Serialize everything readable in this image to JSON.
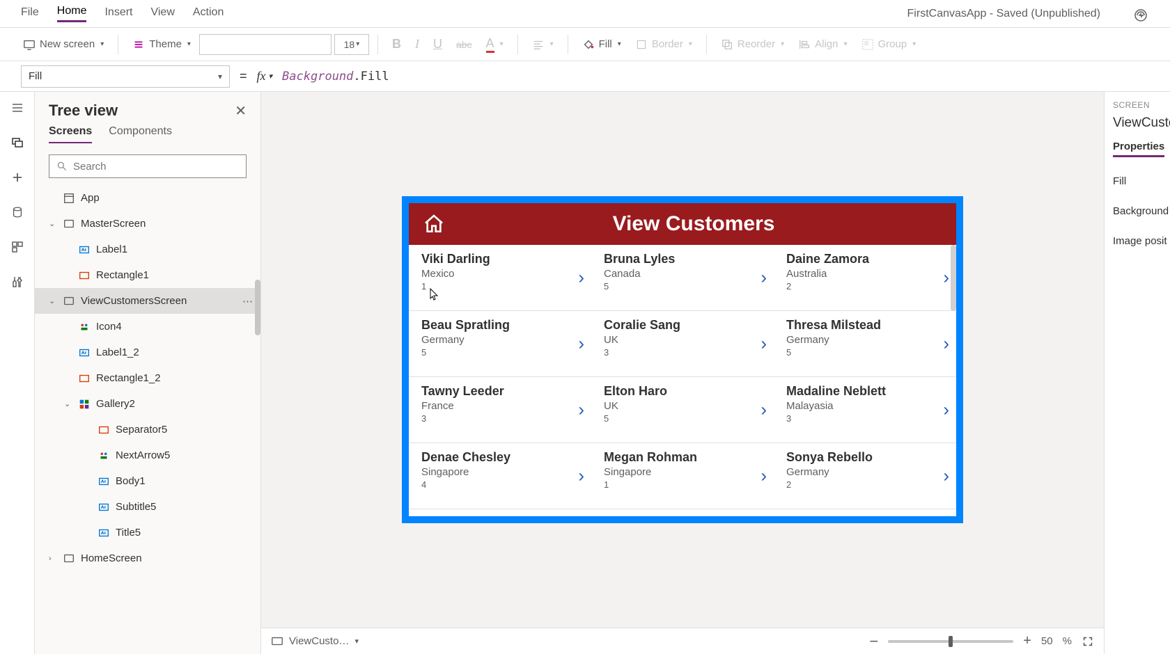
{
  "menu": {
    "file": "File",
    "home": "Home",
    "insert": "Insert",
    "view": "View",
    "action": "Action"
  },
  "appTitle": "FirstCanvasApp - Saved (Unpublished)",
  "ribbon": {
    "newScreen": "New screen",
    "theme": "Theme",
    "fontSize": "18",
    "fill": "Fill",
    "border": "Border",
    "reorder": "Reorder",
    "align": "Align",
    "group": "Group"
  },
  "propertySelector": "Fill",
  "formula": {
    "object": "Background",
    "prop": ".Fill"
  },
  "treeView": {
    "title": "Tree view",
    "tabs": {
      "screens": "Screens",
      "components": "Components"
    },
    "searchPlaceholder": "Search",
    "items": [
      {
        "label": "App",
        "depth": 0,
        "icon": "app",
        "expand": ""
      },
      {
        "label": "MasterScreen",
        "depth": 0,
        "icon": "screen",
        "expand": "v"
      },
      {
        "label": "Label1",
        "depth": 1,
        "icon": "label",
        "expand": ""
      },
      {
        "label": "Rectangle1",
        "depth": 1,
        "icon": "rect",
        "expand": ""
      },
      {
        "label": "ViewCustomersScreen",
        "depth": 0,
        "icon": "screen",
        "expand": "v",
        "selected": true,
        "more": true
      },
      {
        "label": "Icon4",
        "depth": 1,
        "icon": "iconctrl",
        "expand": ""
      },
      {
        "label": "Label1_2",
        "depth": 1,
        "icon": "label",
        "expand": ""
      },
      {
        "label": "Rectangle1_2",
        "depth": 1,
        "icon": "rect",
        "expand": ""
      },
      {
        "label": "Gallery2",
        "depth": 1,
        "icon": "gallery",
        "expand": "v"
      },
      {
        "label": "Separator5",
        "depth": 2,
        "icon": "rect",
        "expand": ""
      },
      {
        "label": "NextArrow5",
        "depth": 2,
        "icon": "iconctrl",
        "expand": ""
      },
      {
        "label": "Body1",
        "depth": 2,
        "icon": "label",
        "expand": ""
      },
      {
        "label": "Subtitle5",
        "depth": 2,
        "icon": "label",
        "expand": ""
      },
      {
        "label": "Title5",
        "depth": 2,
        "icon": "label",
        "expand": ""
      },
      {
        "label": "HomeScreen",
        "depth": 0,
        "icon": "screen",
        "expand": ">"
      }
    ]
  },
  "canvasApp": {
    "header": "View Customers",
    "customers": [
      [
        {
          "name": "Viki Darling",
          "country": "Mexico",
          "num": "1"
        },
        {
          "name": "Bruna Lyles",
          "country": "Canada",
          "num": "5"
        },
        {
          "name": "Daine Zamora",
          "country": "Australia",
          "num": "2"
        }
      ],
      [
        {
          "name": "Beau Spratling",
          "country": "Germany",
          "num": "5"
        },
        {
          "name": "Coralie Sang",
          "country": "UK",
          "num": "3"
        },
        {
          "name": "Thresa Milstead",
          "country": "Germany",
          "num": "5"
        }
      ],
      [
        {
          "name": "Tawny Leeder",
          "country": "France",
          "num": "3"
        },
        {
          "name": "Elton Haro",
          "country": "UK",
          "num": "5"
        },
        {
          "name": "Madaline Neblett",
          "country": "Malayasia",
          "num": "3"
        }
      ],
      [
        {
          "name": "Denae Chesley",
          "country": "Singapore",
          "num": "4"
        },
        {
          "name": "Megan Rohman",
          "country": "Singapore",
          "num": "1"
        },
        {
          "name": "Sonya Rebello",
          "country": "Germany",
          "num": "2"
        }
      ]
    ]
  },
  "bottomBar": {
    "screenName": "ViewCusto…",
    "zoom": "50",
    "pct": "%"
  },
  "props": {
    "label": "SCREEN",
    "name": "ViewCusto",
    "tab": "Properties",
    "rows": [
      "Fill",
      "Background",
      "Image posit"
    ]
  }
}
